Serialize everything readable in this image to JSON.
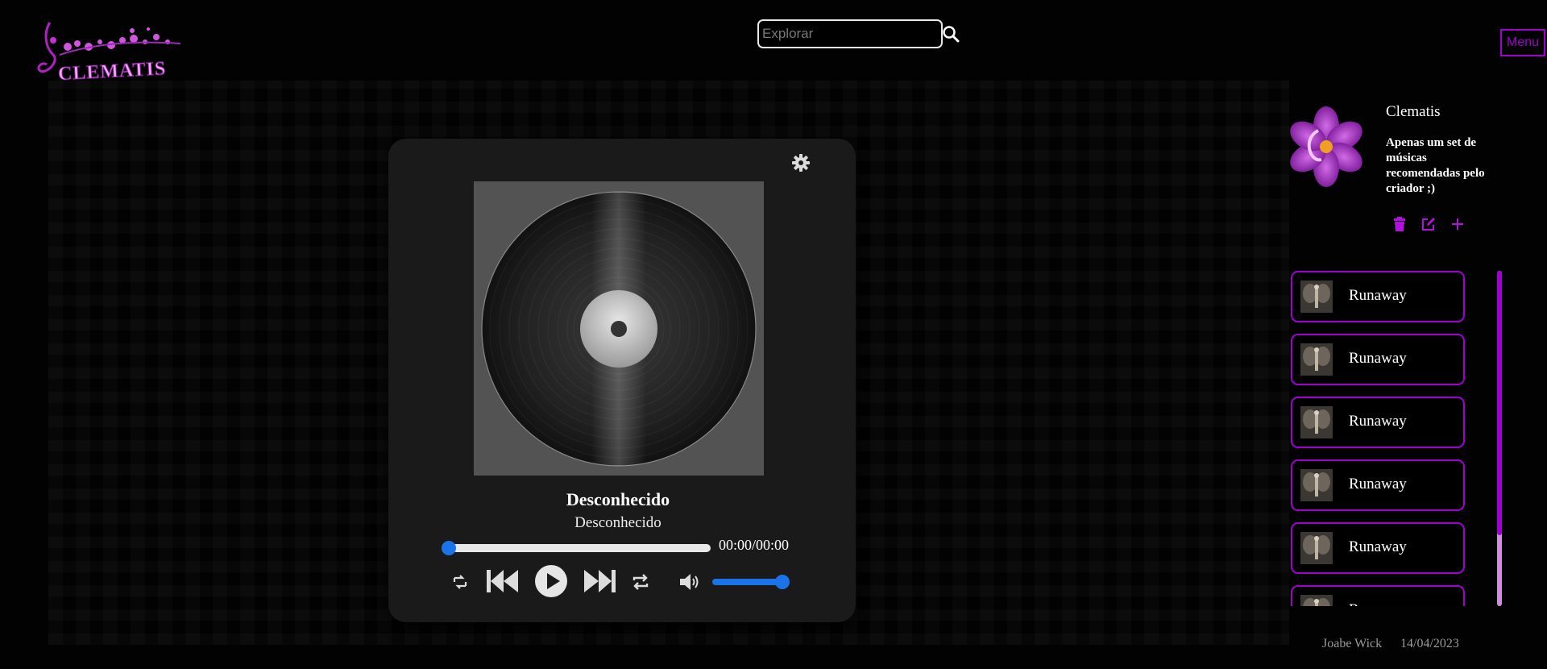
{
  "logo": {
    "text": "CLEMATIS"
  },
  "search": {
    "placeholder": "Explorar",
    "value": ""
  },
  "menu": {
    "label": "Menu"
  },
  "player": {
    "track_title": "Desconhecido",
    "track_artist": "Desconhecido",
    "time": "00:00/00:00",
    "progress_fraction": 0,
    "volume_fraction": 1
  },
  "playlist": {
    "name": "Clematis",
    "description": "Apenas um set de músicas recomendadas pelo criador ;)",
    "songs": [
      {
        "title": "Runaway"
      },
      {
        "title": "Runaway"
      },
      {
        "title": "Runaway"
      },
      {
        "title": "Runaway"
      },
      {
        "title": "Runaway"
      },
      {
        "title": "Runaway"
      }
    ]
  },
  "footer": {
    "author": "Joabe Wick",
    "date": "14/04/2023"
  },
  "colors": {
    "accent": "#a000d0",
    "player_blue": "#1a73e8",
    "card": "#1a1a1a"
  }
}
